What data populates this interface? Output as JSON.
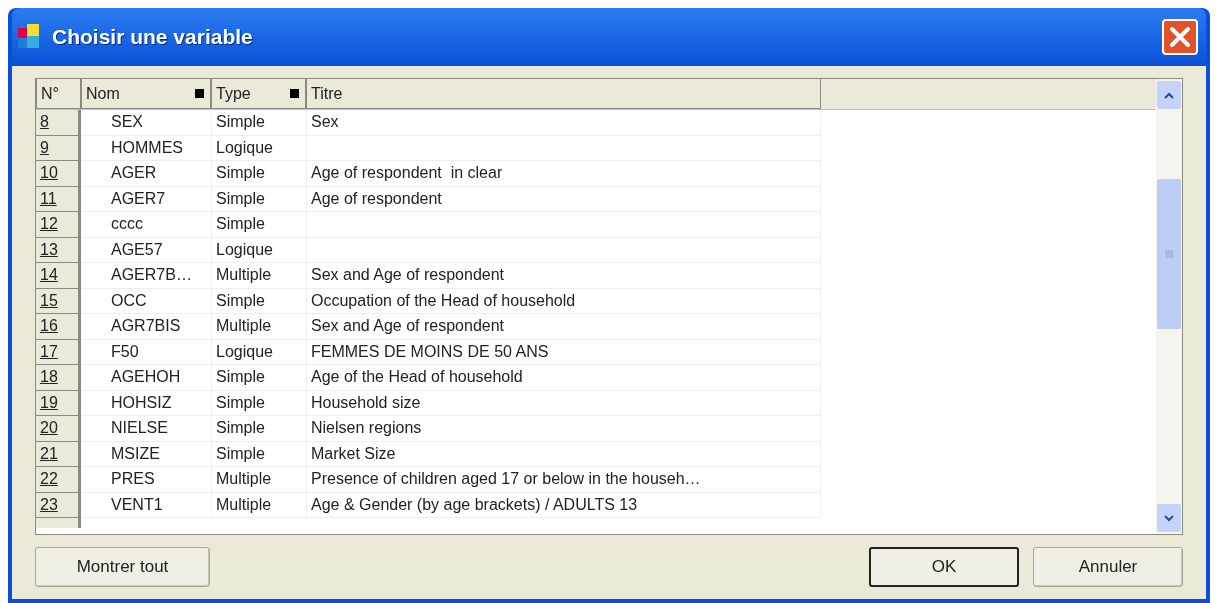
{
  "window": {
    "title": "Choisir une variable"
  },
  "table": {
    "columns": [
      {
        "label": "N°",
        "sortable": false
      },
      {
        "label": "Nom",
        "sortable": true
      },
      {
        "label": "Type",
        "sortable": true
      },
      {
        "label": "Titre",
        "sortable": false
      }
    ],
    "rows": [
      {
        "n": "8",
        "nom": "SEX",
        "type": "Simple",
        "titre": "Sex"
      },
      {
        "n": "9",
        "nom": "HOMMES",
        "type": "Logique",
        "titre": ""
      },
      {
        "n": "10",
        "nom": "AGER",
        "type": "Simple",
        "titre": "Age of respondent  in clear"
      },
      {
        "n": "11",
        "nom": "AGER7",
        "type": "Simple",
        "titre": "Age of respondent"
      },
      {
        "n": "12",
        "nom": "cccc",
        "type": "Simple",
        "titre": ""
      },
      {
        "n": "13",
        "nom": "AGE57",
        "type": "Logique",
        "titre": ""
      },
      {
        "n": "14",
        "nom": "AGER7B…",
        "type": "Multiple",
        "titre": "Sex and Age of respondent"
      },
      {
        "n": "15",
        "nom": "OCC",
        "type": "Simple",
        "titre": "Occupation of the Head of household"
      },
      {
        "n": "16",
        "nom": "AGR7BIS",
        "type": "Multiple",
        "titre": "Sex and Age of respondent"
      },
      {
        "n": "17",
        "nom": "F50",
        "type": "Logique",
        "titre": "FEMMES DE MOINS DE 50 ANS"
      },
      {
        "n": "18",
        "nom": "AGEHOH",
        "type": "Simple",
        "titre": "Age of the Head of household"
      },
      {
        "n": "19",
        "nom": "HOHSIZ",
        "type": "Simple",
        "titre": "Household size"
      },
      {
        "n": "20",
        "nom": "NIELSE",
        "type": "Simple",
        "titre": "Nielsen regions"
      },
      {
        "n": "21",
        "nom": "MSIZE",
        "type": "Simple",
        "titre": "Market Size"
      },
      {
        "n": "22",
        "nom": "PRES",
        "type": "Multiple",
        "titre": "Presence of children aged 17 or below in the househ…"
      },
      {
        "n": "23",
        "nom": "VENT1",
        "type": "Multiple",
        "titre": "Age & Gender (by age brackets) / ADULTS 13"
      }
    ]
  },
  "buttons": [
    {
      "label": "Montrer tout",
      "default": false
    },
    {
      "label": "OK",
      "default": true
    },
    {
      "label": "Annuler",
      "default": false
    }
  ]
}
